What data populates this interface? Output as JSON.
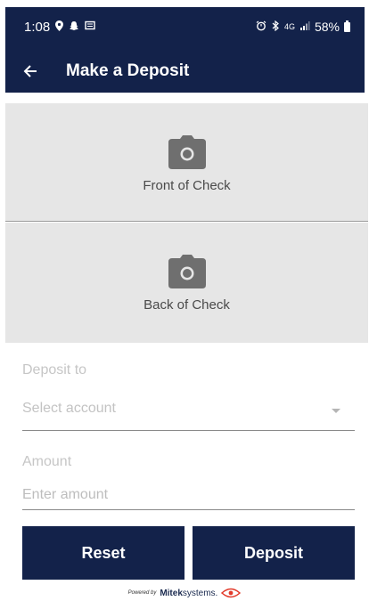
{
  "status_bar": {
    "time": "1:08",
    "battery": "58%",
    "network": "4G"
  },
  "app_bar": {
    "title": "Make a Deposit"
  },
  "capture": {
    "front_label": "Front of Check",
    "back_label": "Back of Check"
  },
  "form": {
    "deposit_to_label": "Deposit to",
    "account_placeholder": "Select account",
    "amount_label": "Amount",
    "amount_placeholder": "Enter amount"
  },
  "buttons": {
    "reset": "Reset",
    "deposit": "Deposit"
  },
  "footer": {
    "powered_by": "Powered by",
    "brand_bold": "Mitek",
    "brand_rest": "systems."
  },
  "colors": {
    "primary": "#13224a",
    "capture_bg": "#e6e6e6",
    "camera_icon": "#6f6f6f",
    "brand_accent": "#e23a2a"
  }
}
